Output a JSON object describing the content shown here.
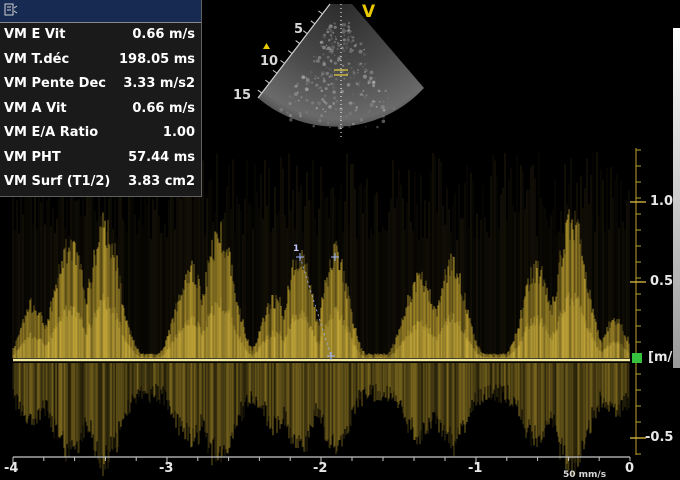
{
  "measurements": [
    {
      "label": "VM E Vit",
      "value": "0.66 m/s"
    },
    {
      "label": "VM T.déc",
      "value": "198.05 ms"
    },
    {
      "label": "VM Pente Dec",
      "value": "3.33 m/s2"
    },
    {
      "label": "VM A Vit",
      "value": "0.66 m/s"
    },
    {
      "label": "VM E/A Ratio",
      "value": "1.00"
    },
    {
      "label": "VM PHT",
      "value": "57.44 ms"
    },
    {
      "label": "VM Surf (T1/2)",
      "value": "3.83 cm2"
    }
  ],
  "sector": {
    "orientation_marker": "V",
    "depth_labels": [
      "5",
      "10",
      "15"
    ]
  },
  "doppler": {
    "velocity_unit": "[m/s]",
    "velocity_ticks": [
      "1.0",
      "0.5",
      "-0.5"
    ],
    "time_ticks": [
      "-4",
      "-3",
      "-2",
      "-1",
      "0"
    ],
    "sweep_speed": "50 mm/s",
    "caliper_label": "1"
  },
  "colors": {
    "spectrum": "#e6c23a",
    "baseline": "#f0e89a",
    "panel_header": "#172a52",
    "marker": "#e8c800",
    "zero_marker": "#36c23e"
  }
}
